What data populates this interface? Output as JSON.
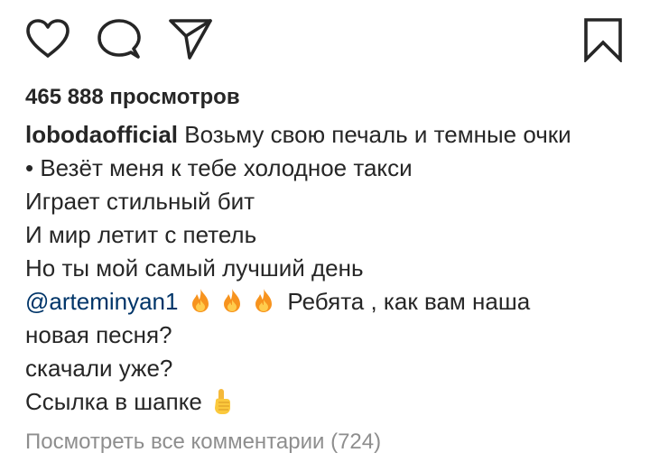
{
  "actions": {
    "like_icon": "heart-outline",
    "comment_icon": "speech-bubble-outline",
    "share_icon": "paper-plane-outline",
    "save_icon": "bookmark-outline"
  },
  "views_text": "465 888 просмотров",
  "caption": {
    "username": "lobodaofficial",
    "first_line": "Возьму свою печаль и темные очки",
    "lines": [
      "• Везёт  меня к тебе холодное такси",
      "Играет стильный бит",
      "И мир летит с петель",
      "Но ты мой самый лучший день"
    ],
    "mention": "@arteminyan1",
    "mention_tail": "Ребята , как вам наша",
    "tail_lines": [
      "новая песня?",
      "скачали уже?",
      "Ссылка в шапке"
    ],
    "emoji_fire": "fire",
    "emoji_point": "point-up"
  },
  "view_comments_text": "Посмотреть все комментарии (724)",
  "colors": {
    "text": "#262626",
    "mention": "#003569",
    "muted": "#8e8e8e",
    "fire": "#f7931e",
    "fire_inner": "#ffcc4d"
  }
}
